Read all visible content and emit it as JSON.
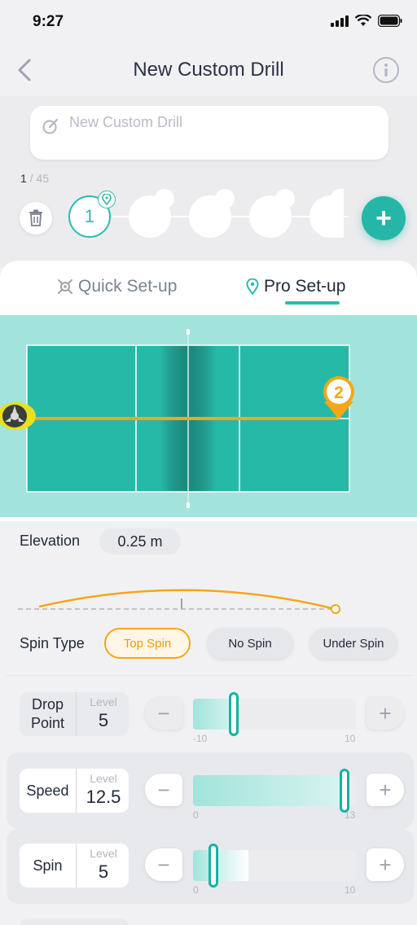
{
  "status_bar": {
    "time": "9:27"
  },
  "header": {
    "title": "New Custom Drill"
  },
  "drill_name": {
    "placeholder": "New Custom Drill"
  },
  "counter": {
    "current": "1",
    "total": " / 45"
  },
  "steps": {
    "active_number": "1"
  },
  "tabs": {
    "quick": "Quick Set-up",
    "pro": "Pro Set-up"
  },
  "court": {
    "target_number": "2"
  },
  "elevation": {
    "label": "Elevation",
    "value": "0.25 m"
  },
  "spin_type": {
    "label": "Spin Type",
    "options": [
      "Top Spin",
      "No Spin",
      "Under Spin"
    ],
    "selected": "Top Spin"
  },
  "controls": [
    {
      "name": "Drop Point",
      "level_label": "Level",
      "value": "5",
      "min": "-10",
      "max": "10",
      "fraction": 0.25
    },
    {
      "name": "Speed",
      "level_label": "Level",
      "value": "12.5",
      "min": "0",
      "max": "13",
      "fraction": 0.93
    },
    {
      "name": "Spin",
      "level_label": "Level",
      "value": "5",
      "min": "0",
      "max": "10",
      "fraction": 0.125
    }
  ],
  "colors": {
    "accent": "#2bbcac",
    "orange": "#f5a716",
    "court": "#27b9a8",
    "court_bg": "#a2e4dc"
  }
}
